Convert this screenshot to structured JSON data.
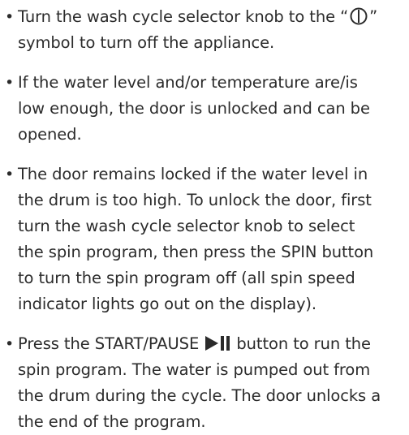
{
  "doc": {
    "bullet_glyph": "•",
    "items": [
      {
        "line1_before": "Turn the wash cycle selector knob to the “",
        "power_icon": "power-off-symbol-icon",
        "line1_after": "”",
        "line2": "symbol to turn off the appliance."
      },
      {
        "lines": [
          "If the water level and/or temperature are/is",
          "low enough, the door is unlocked and can be",
          "opened."
        ]
      },
      {
        "lines": [
          "The door remains locked if the water level in",
          "the drum is too high. To unlock the door, first",
          "turn the wash cycle selector knob to select",
          "the spin program, then press the SPIN button",
          "to turn the spin program off (all spin speed",
          "indicator lights go out on the display)."
        ]
      },
      {
        "line1_before": "Press the START/PAUSE",
        "playpause_icon": "play-pause-icon",
        "line1_after": "button to run the",
        "lines": [
          "spin program. The water is pumped out from",
          "the drum during the cycle. The door unlocks a",
          "the end of the program."
        ]
      }
    ]
  }
}
